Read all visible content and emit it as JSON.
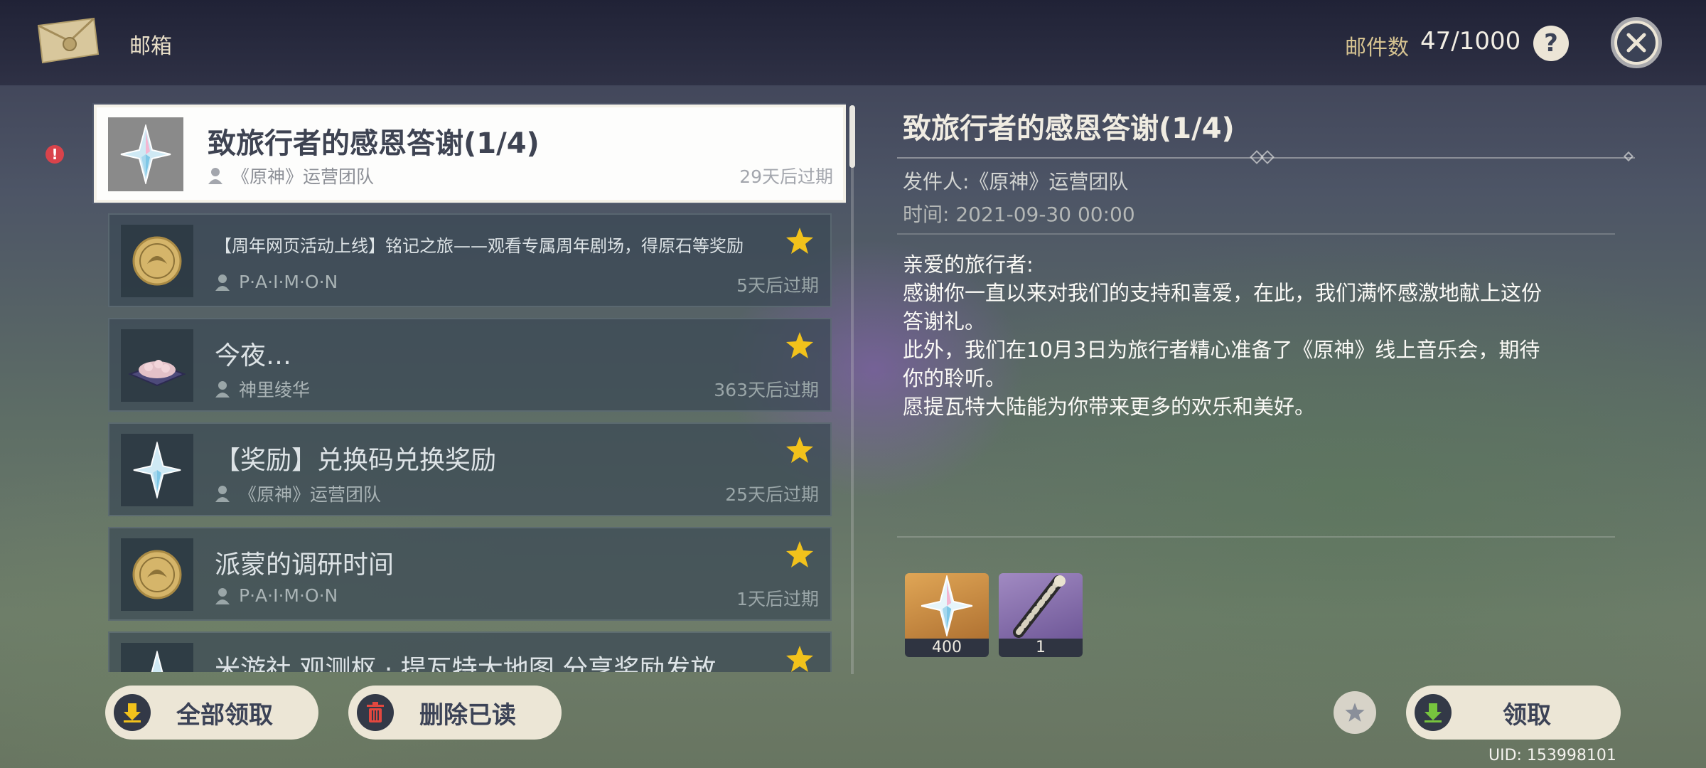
{
  "header": {
    "title": "邮箱",
    "count_label": "邮件数",
    "count_value": "47/1000",
    "help_symbol": "?",
    "icons": [
      "envelope-icon",
      "help-icon",
      "close-icon"
    ]
  },
  "alert": {
    "symbol": "!"
  },
  "mail_list": [
    {
      "title": "致旅行者的感恩答谢(1/4)",
      "sender": "《原神》运营团队",
      "expire": "29天后过期",
      "selected": true,
      "thumb": "primogem",
      "starred": false
    },
    {
      "title": "【周年网页活动上线】铭记之旅——观看专属周年剧场，得原石等奖励",
      "sender": "P·A·I·M·O·N",
      "expire": "5天后过期",
      "selected": false,
      "thumb": "coin",
      "starred": true
    },
    {
      "title": "今夜…",
      "sender": "神里绫华",
      "expire": "363天后过期",
      "selected": false,
      "thumb": "food-tray",
      "starred": true
    },
    {
      "title": "【奖励】兑换码兑换奖励",
      "sender": "《原神》运营团队",
      "expire": "25天后过期",
      "selected": false,
      "thumb": "primogem",
      "starred": true
    },
    {
      "title": "派蒙的调研时间",
      "sender": "P·A·I·M·O·N",
      "expire": "1天后过期",
      "selected": false,
      "thumb": "coin",
      "starred": true
    },
    {
      "title": "米游社 观测枢 · 提瓦特大地图 分享奖励发放",
      "sender": "",
      "expire": "",
      "selected": false,
      "thumb": "primogem",
      "starred": true
    }
  ],
  "detail": {
    "title": "致旅行者的感恩答谢(1/4)",
    "sender": "发件人:《原神》运营团队",
    "time": "时间: 2021-09-30 00:00",
    "body": [
      "亲爱的旅行者:",
      "感谢你一直以来对我们的支持和喜爱，在此，我们满怀感激地献上这份",
      "答谢礼。",
      "此外，我们在10月3日为旅行者精心准备了《原神》线上音乐会，期待",
      "你的聆听。",
      "愿提瓦特大陆能为你带来更多的欢乐和美好。"
    ],
    "rewards": [
      {
        "count": "400",
        "icon": "primogem-icon",
        "rarity_color": "#c98a3e"
      },
      {
        "count": "1",
        "icon": "namecard-icon",
        "rarity_color": "#8b6fb0"
      }
    ]
  },
  "buttons": {
    "claim_all": "全部领取",
    "delete_read": "删除已读",
    "claim": "领取"
  },
  "uid": "UID: 153998101",
  "colors": {
    "accent_gold": "#d6c391",
    "button_bg": "#ece6d6",
    "star": "#f2c21b",
    "alert": "#d9434b"
  }
}
